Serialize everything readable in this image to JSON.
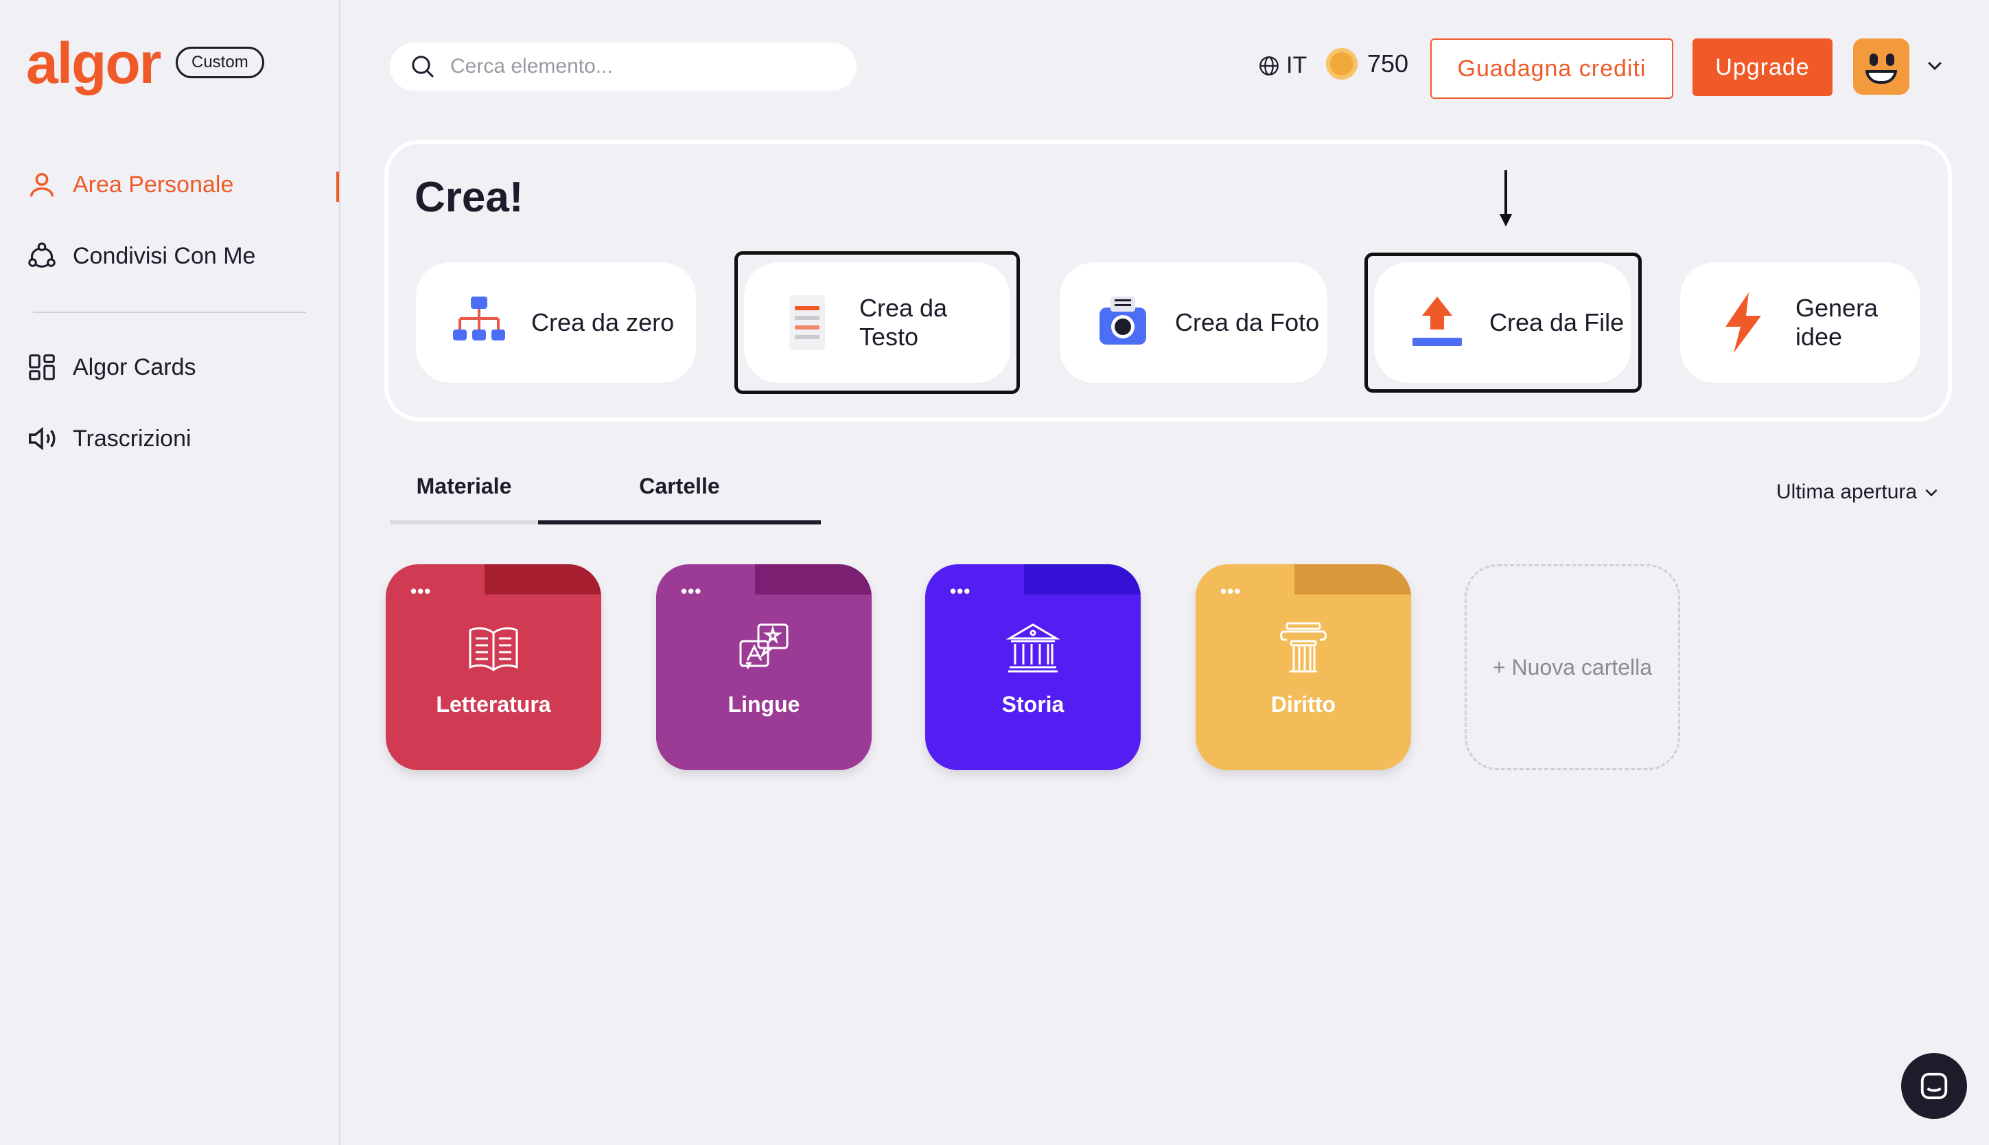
{
  "brand": {
    "logo": "algor",
    "badge": "Custom",
    "accent": "#f05a28"
  },
  "sidebar": {
    "items": [
      {
        "label": "Area Personale",
        "icon": "user-icon",
        "active": true
      },
      {
        "label": "Condivisi Con Me",
        "icon": "share-users-icon"
      },
      {
        "label": "Algor Cards",
        "icon": "cards-grid-icon"
      },
      {
        "label": "Trascrizioni",
        "icon": "speaker-icon"
      }
    ]
  },
  "header": {
    "search_placeholder": "Cerca elemento...",
    "language": "IT",
    "credits": "750",
    "earn_credits_label": "Guadagna crediti",
    "upgrade_label": "Upgrade"
  },
  "create": {
    "title": "Crea!",
    "options": [
      {
        "label": "Crea da zero",
        "icon": "mindmap-icon"
      },
      {
        "label": "Crea da Testo",
        "icon": "text-document-icon",
        "highlighted": true
      },
      {
        "label": "Crea da Foto",
        "icon": "camera-icon"
      },
      {
        "label": "Crea da File",
        "icon": "upload-icon",
        "highlighted": true
      },
      {
        "label": "Genera idee",
        "icon": "lightning-icon"
      }
    ]
  },
  "content": {
    "tabs": [
      {
        "label": "Materiale"
      },
      {
        "label": "Cartelle",
        "active": true
      }
    ],
    "sort_label": "Ultima apertura",
    "folders": [
      {
        "name": "Letteratura",
        "color": "#d03a52",
        "tab_color": "#a81f32",
        "icon": "open-book-icon"
      },
      {
        "name": "Lingue",
        "color": "#9b3b95",
        "tab_color": "#7a1f72",
        "icon": "translate-icon"
      },
      {
        "name": "Storia",
        "color": "#541ef2",
        "tab_color": "#3310d4",
        "icon": "museum-icon"
      },
      {
        "name": "Diritto",
        "color": "#f3bc58",
        "tab_color": "#d9983a",
        "icon": "column-icon"
      }
    ],
    "more_label": "•••",
    "new_folder_label": "+ Nuova cartella"
  }
}
